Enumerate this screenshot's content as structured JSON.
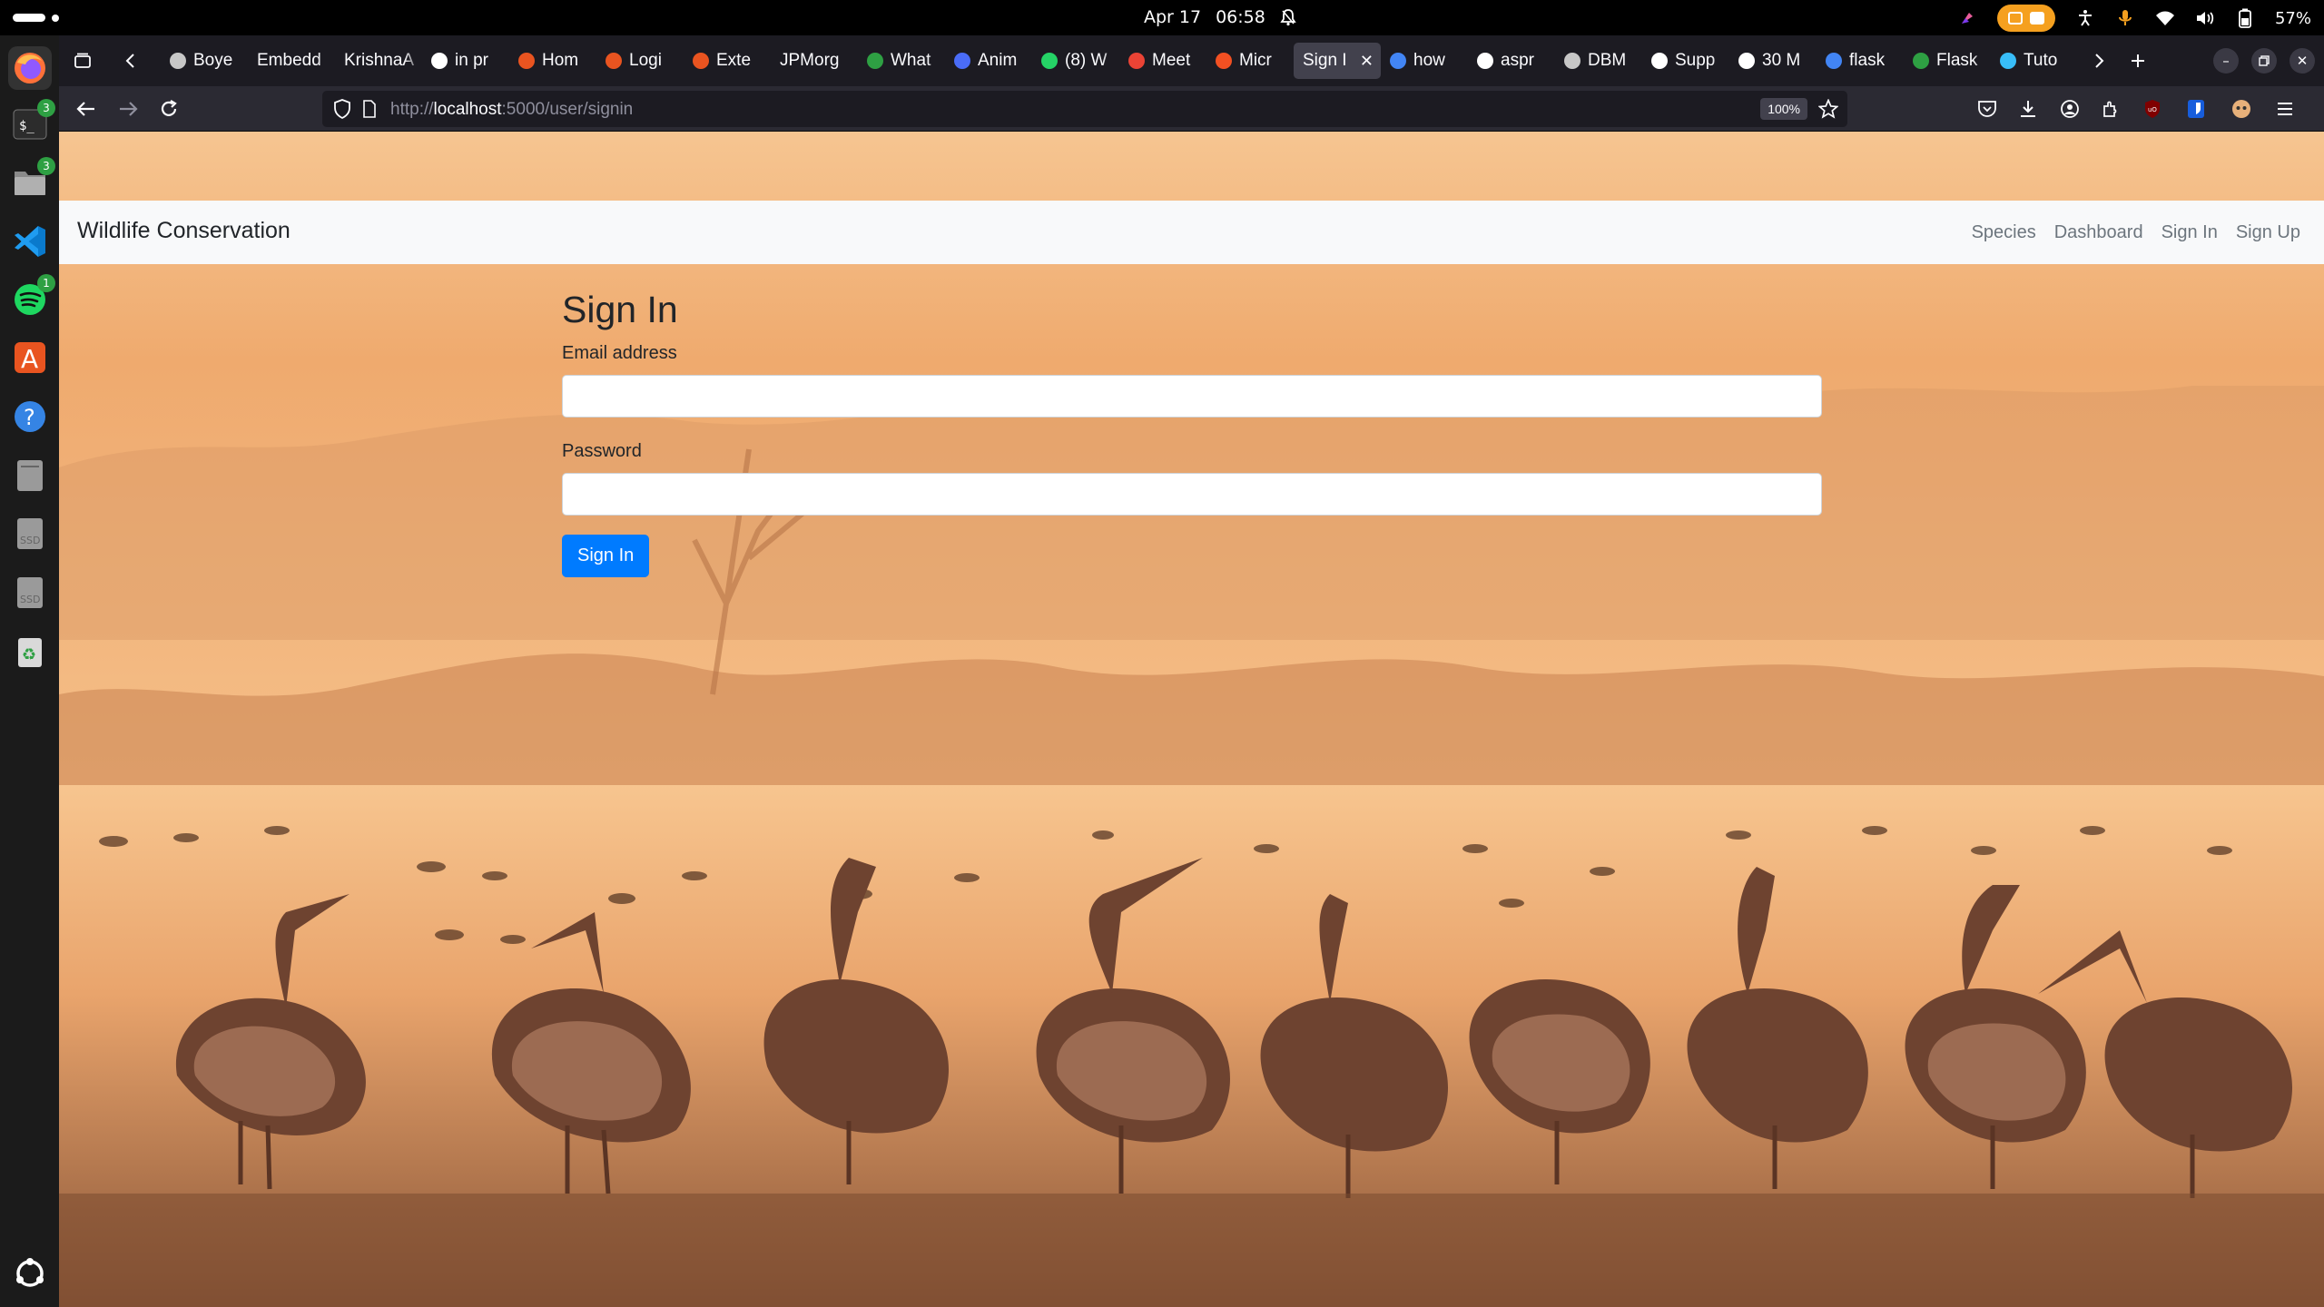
{
  "system": {
    "date": "Apr 17",
    "time": "06:58",
    "battery": "57%"
  },
  "browser": {
    "tabs": [
      {
        "label": "Boye",
        "color": "#c7c7c7"
      },
      {
        "label": "Embedd",
        "color": ""
      },
      {
        "label": "KrishnaA",
        "color": ""
      },
      {
        "label": "in pr",
        "color": "#ffffff"
      },
      {
        "label": "Hom",
        "color": "#e95420"
      },
      {
        "label": "Logi",
        "color": "#e95420"
      },
      {
        "label": "Exte",
        "color": "#e95420"
      },
      {
        "label": "JPMorg",
        "color": ""
      },
      {
        "label": "What",
        "color": "#2ea043"
      },
      {
        "label": "Anim",
        "color": "#4a6cf7"
      },
      {
        "label": "(8) W",
        "color": "#25d366"
      },
      {
        "label": "Meet",
        "color": "#ea4335"
      },
      {
        "label": "Micr",
        "color": "#f25022"
      },
      {
        "label": "Sign I",
        "color": "",
        "active": true
      },
      {
        "label": "how",
        "color": "#4285f4"
      },
      {
        "label": "aspr",
        "color": "#ffffff"
      },
      {
        "label": "DBM",
        "color": "#c7c7c7"
      },
      {
        "label": "Supp",
        "color": "#ffffff"
      },
      {
        "label": "30 M",
        "color": "#ffffff"
      },
      {
        "label": "flask",
        "color": "#4285f4"
      },
      {
        "label": "Flask",
        "color": "#2ea043"
      },
      {
        "label": "Tuto",
        "color": "#38bdf8"
      }
    ],
    "url_prefix": "http://",
    "url_host": "localhost",
    "url_path": ":5000/user/signin",
    "zoom": "100%"
  },
  "site": {
    "brand": "Wildlife Conservation",
    "nav": [
      "Species",
      "Dashboard",
      "Sign In",
      "Sign Up"
    ]
  },
  "signin": {
    "title": "Sign In",
    "email_label": "Email address",
    "email_value": "",
    "password_label": "Password",
    "password_value": "",
    "submit_label": "Sign In"
  },
  "colors": {
    "accent": "#007bff",
    "navbar_bg": "#f8f9fa",
    "ubuntu_orange": "#e95420"
  },
  "icons": [
    "firefox-icon",
    "terminal-icon",
    "files-icon",
    "vscode-icon",
    "spotify-icon",
    "app-center-icon",
    "help-icon",
    "drive-icon",
    "trash-icon",
    "show-apps-icon"
  ]
}
